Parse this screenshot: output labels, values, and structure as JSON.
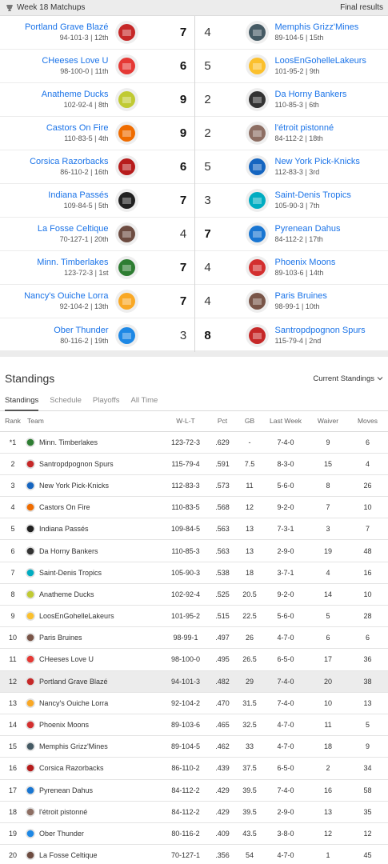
{
  "header": {
    "title": "Week 18 Matchups",
    "status": "Final results"
  },
  "matchups": [
    {
      "home": {
        "name": "Portland Grave Blazé",
        "record": "94-101-3 | 12th",
        "score": "7",
        "logo_color": "#c62828"
      },
      "away": {
        "name": "Memphis Grizz'Mines",
        "record": "89-104-5 | 15th",
        "score": "4",
        "logo_color": "#455a64"
      },
      "winner": "home"
    },
    {
      "home": {
        "name": "CHeeses Love U",
        "record": "98-100-0 | 11th",
        "score": "6",
        "logo_color": "#e53935"
      },
      "away": {
        "name": "LoosEnGohelleLakeurs",
        "record": "101-95-2 | 9th",
        "score": "5",
        "logo_color": "#fbc02d"
      },
      "winner": "home"
    },
    {
      "home": {
        "name": "Anatheme Ducks",
        "record": "102-92-4 | 8th",
        "score": "9",
        "logo_color": "#c0ca33"
      },
      "away": {
        "name": "Da Horny Bankers",
        "record": "110-85-3 | 6th",
        "score": "2",
        "logo_color": "#333333"
      },
      "winner": "home"
    },
    {
      "home": {
        "name": "Castors On Fire",
        "record": "110-83-5 | 4th",
        "score": "9",
        "logo_color": "#ef6c00"
      },
      "away": {
        "name": "l'étroit pistonné",
        "record": "84-112-2 | 18th",
        "score": "2",
        "logo_color": "#8d6e63"
      },
      "winner": "home"
    },
    {
      "home": {
        "name": "Corsica Razorbacks",
        "record": "86-110-2 | 16th",
        "score": "6",
        "logo_color": "#b71c1c"
      },
      "away": {
        "name": "New York Pick-Knicks",
        "record": "112-83-3 | 3rd",
        "score": "5",
        "logo_color": "#1565c0"
      },
      "winner": "home"
    },
    {
      "home": {
        "name": "Indiana Passés",
        "record": "109-84-5 | 5th",
        "score": "7",
        "logo_color": "#212121"
      },
      "away": {
        "name": "Saint-Denis Tropics",
        "record": "105-90-3 | 7th",
        "score": "3",
        "logo_color": "#00acc1"
      },
      "winner": "home"
    },
    {
      "home": {
        "name": "La Fosse Celtique",
        "record": "70-127-1 | 20th",
        "score": "4",
        "logo_color": "#6d4c41"
      },
      "away": {
        "name": "Pyrenean Dahus",
        "record": "84-112-2 | 17th",
        "score": "7",
        "logo_color": "#1976d2"
      },
      "winner": "away"
    },
    {
      "home": {
        "name": "Minn. Timberlakes",
        "record": "123-72-3 | 1st",
        "score": "7",
        "logo_color": "#2e7d32"
      },
      "away": {
        "name": "Phoenix Moons",
        "record": "89-103-6 | 14th",
        "score": "4",
        "logo_color": "#d32f2f"
      },
      "winner": "home"
    },
    {
      "home": {
        "name": "Nancy's Ouiche Lorra",
        "record": "92-104-2 | 13th",
        "score": "7",
        "logo_color": "#f9a825"
      },
      "away": {
        "name": "Paris Bruines",
        "record": "98-99-1 | 10th",
        "score": "4",
        "logo_color": "#795548"
      },
      "winner": "home"
    },
    {
      "home": {
        "name": "Ober Thunder",
        "record": "80-116-2 | 19th",
        "score": "3",
        "logo_color": "#1e88e5"
      },
      "away": {
        "name": "Santropdpognon Spurs",
        "record": "115-79-4 | 2nd",
        "score": "8",
        "logo_color": "#c62828"
      },
      "winner": "away"
    }
  ],
  "standings": {
    "title": "Standings",
    "dropdown": "Current Standings",
    "tabs": [
      "Standings",
      "Schedule",
      "Playoffs",
      "All Time"
    ],
    "columns": [
      "Rank",
      "Team",
      "W-L-T",
      "Pct",
      "GB",
      "Last Week",
      "Waiver",
      "Moves"
    ],
    "rows": [
      {
        "rank": "*1",
        "team": "Minn. Timberlakes",
        "wlt": "123-72-3",
        "pct": ".629",
        "gb": "-",
        "last": "7-4-0",
        "waiver": "9",
        "moves": "6",
        "color": "#2e7d32"
      },
      {
        "rank": "2",
        "team": "Santropdpognon Spurs",
        "wlt": "115-79-4",
        "pct": ".591",
        "gb": "7.5",
        "last": "8-3-0",
        "waiver": "15",
        "moves": "4",
        "color": "#c62828"
      },
      {
        "rank": "3",
        "team": "New York Pick-Knicks",
        "wlt": "112-83-3",
        "pct": ".573",
        "gb": "11",
        "last": "5-6-0",
        "waiver": "8",
        "moves": "26",
        "color": "#1565c0"
      },
      {
        "rank": "4",
        "team": "Castors On Fire",
        "wlt": "110-83-5",
        "pct": ".568",
        "gb": "12",
        "last": "9-2-0",
        "waiver": "7",
        "moves": "10",
        "color": "#ef6c00"
      },
      {
        "rank": "5",
        "team": "Indiana Passés",
        "wlt": "109-84-5",
        "pct": ".563",
        "gb": "13",
        "last": "7-3-1",
        "waiver": "3",
        "moves": "7",
        "color": "#212121"
      },
      {
        "rank": "6",
        "team": "Da Horny Bankers",
        "wlt": "110-85-3",
        "pct": ".563",
        "gb": "13",
        "last": "2-9-0",
        "waiver": "19",
        "moves": "48",
        "color": "#333333"
      },
      {
        "rank": "7",
        "team": "Saint-Denis Tropics",
        "wlt": "105-90-3",
        "pct": ".538",
        "gb": "18",
        "last": "3-7-1",
        "waiver": "4",
        "moves": "16",
        "color": "#00acc1"
      },
      {
        "rank": "8",
        "team": "Anatheme Ducks",
        "wlt": "102-92-4",
        "pct": ".525",
        "gb": "20.5",
        "last": "9-2-0",
        "waiver": "14",
        "moves": "10",
        "color": "#c0ca33"
      },
      {
        "rank": "9",
        "team": "LoosEnGohelleLakeurs",
        "wlt": "101-95-2",
        "pct": ".515",
        "gb": "22.5",
        "last": "5-6-0",
        "waiver": "5",
        "moves": "28",
        "color": "#fbc02d"
      },
      {
        "rank": "10",
        "team": "Paris Bruines",
        "wlt": "98-99-1",
        "pct": ".497",
        "gb": "26",
        "last": "4-7-0",
        "waiver": "6",
        "moves": "6",
        "color": "#795548"
      },
      {
        "rank": "11",
        "team": "CHeeses Love U",
        "wlt": "98-100-0",
        "pct": ".495",
        "gb": "26.5",
        "last": "6-5-0",
        "waiver": "17",
        "moves": "36",
        "color": "#e53935"
      },
      {
        "rank": "12",
        "team": "Portland Grave Blazé",
        "wlt": "94-101-3",
        "pct": ".482",
        "gb": "29",
        "last": "7-4-0",
        "waiver": "20",
        "moves": "38",
        "color": "#c62828",
        "highlight": true
      },
      {
        "rank": "13",
        "team": "Nancy's Ouiche Lorra",
        "wlt": "92-104-2",
        "pct": ".470",
        "gb": "31.5",
        "last": "7-4-0",
        "waiver": "10",
        "moves": "13",
        "color": "#f9a825"
      },
      {
        "rank": "14",
        "team": "Phoenix Moons",
        "wlt": "89-103-6",
        "pct": ".465",
        "gb": "32.5",
        "last": "4-7-0",
        "waiver": "11",
        "moves": "5",
        "color": "#d32f2f"
      },
      {
        "rank": "15",
        "team": "Memphis Grizz'Mines",
        "wlt": "89-104-5",
        "pct": ".462",
        "gb": "33",
        "last": "4-7-0",
        "waiver": "18",
        "moves": "9",
        "color": "#455a64"
      },
      {
        "rank": "16",
        "team": "Corsica Razorbacks",
        "wlt": "86-110-2",
        "pct": ".439",
        "gb": "37.5",
        "last": "6-5-0",
        "waiver": "2",
        "moves": "34",
        "color": "#b71c1c"
      },
      {
        "rank": "17",
        "team": "Pyrenean Dahus",
        "wlt": "84-112-2",
        "pct": ".429",
        "gb": "39.5",
        "last": "7-4-0",
        "waiver": "16",
        "moves": "58",
        "color": "#1976d2"
      },
      {
        "rank": "18",
        "team": "l'étroit pistonné",
        "wlt": "84-112-2",
        "pct": ".429",
        "gb": "39.5",
        "last": "2-9-0",
        "waiver": "13",
        "moves": "35",
        "color": "#8d6e63"
      },
      {
        "rank": "19",
        "team": "Ober Thunder",
        "wlt": "80-116-2",
        "pct": ".409",
        "gb": "43.5",
        "last": "3-8-0",
        "waiver": "12",
        "moves": "12",
        "color": "#1e88e5"
      },
      {
        "rank": "20",
        "team": "La Fosse Celtique",
        "wlt": "70-127-1",
        "pct": ".356",
        "gb": "54",
        "last": "4-7-0",
        "waiver": "1",
        "moves": "45",
        "color": "#6d4c41"
      }
    ]
  }
}
